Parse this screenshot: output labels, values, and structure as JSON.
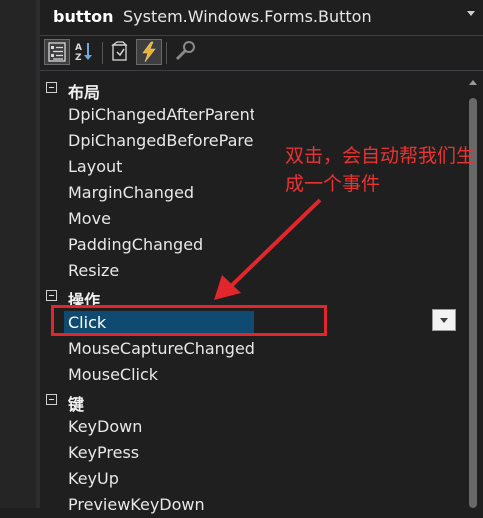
{
  "header": {
    "object_name": "button",
    "object_type": "System.Windows.Forms.Button"
  },
  "toolbar": {
    "buttons": [
      {
        "icon": "categorized-icon",
        "active": true
      },
      {
        "icon": "alphabetical-icon",
        "active": false
      },
      {
        "icon": "properties-icon",
        "active": false
      },
      {
        "icon": "events-lightning-icon",
        "active": true
      },
      {
        "icon": "property-pages-wrench-icon",
        "active": false
      }
    ]
  },
  "categories": [
    {
      "label": "布局",
      "items": [
        "DpiChangedAfterParent",
        "DpiChangedBeforeParent",
        "Layout",
        "MarginChanged",
        "Move",
        "PaddingChanged",
        "Resize"
      ]
    },
    {
      "label": "操作",
      "items": [
        "Click",
        "MouseCaptureChanged",
        "MouseClick"
      ]
    },
    {
      "label": "键",
      "items": [
        "KeyDown",
        "KeyPress",
        "KeyUp",
        "PreviewKeyDown"
      ]
    }
  ],
  "selected_item": "Click",
  "annotation": {
    "text": "双击，会自动帮我们生成一个事件",
    "color": "#e2262b"
  }
}
